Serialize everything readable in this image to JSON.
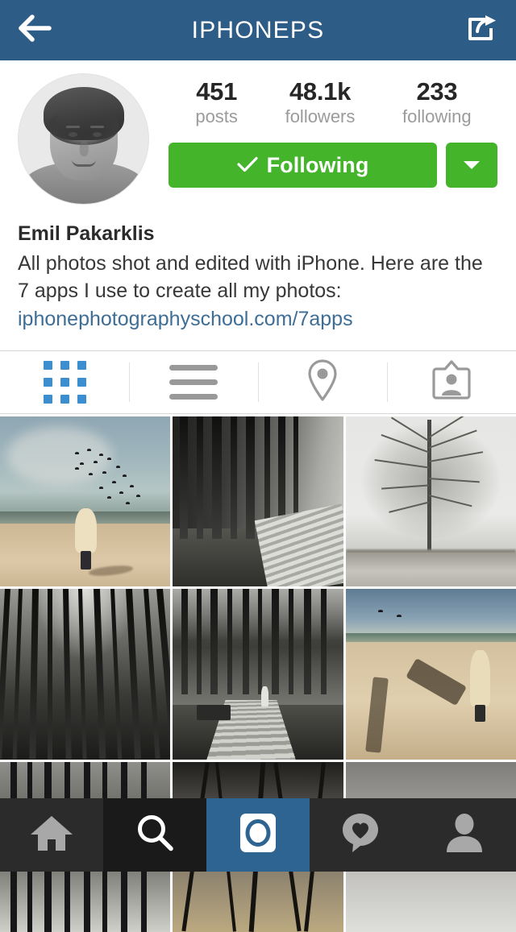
{
  "header": {
    "title": "IPHONEPS",
    "back_icon": "back-arrow-icon",
    "share_icon": "share-icon",
    "background_color": "#2d5c87"
  },
  "profile": {
    "avatar_alt": "profile-photo",
    "stats": [
      {
        "value": "451",
        "label": "posts"
      },
      {
        "value": "48.1k",
        "label": "followers"
      },
      {
        "value": "233",
        "label": "following"
      }
    ],
    "follow_button": {
      "label": "Following",
      "icon": "checkmark-icon",
      "color": "#44b52b"
    },
    "dropdown_button": {
      "icon": "caret-down-icon",
      "color": "#44b52b"
    },
    "bio": {
      "name": "Emil Pakarklis",
      "description": "All photos shot and edited with iPhone. Here are the 7 apps I use to create all my photos:",
      "link": "iphonephotographyschool.com/7apps",
      "link_color": "#3e6e96"
    }
  },
  "tabs": [
    {
      "name": "grid-view",
      "icon": "grid-icon",
      "active": true
    },
    {
      "name": "list-view",
      "icon": "list-icon",
      "active": false
    },
    {
      "name": "photo-map",
      "icon": "location-pin-icon",
      "active": false
    },
    {
      "name": "photos-of-you",
      "icon": "tagged-badge-icon",
      "active": false
    }
  ],
  "tab_active_color": "#3b8ed0",
  "tab_inactive_color": "#999999",
  "photos": [
    {
      "name": "beach-person-birds",
      "alt": "Person in cream coat on beach with flock of birds"
    },
    {
      "name": "forest-boardwalk-bw",
      "alt": "Black and white pine forest with boardwalk path"
    },
    {
      "name": "winter-bare-tree",
      "alt": "Bare tree in snowy winter field"
    },
    {
      "name": "forest-canopy-dark",
      "alt": "Dark tall pine trees looking upward"
    },
    {
      "name": "forest-path-figure",
      "alt": "Boardwalk through forest with distant figure"
    },
    {
      "name": "beach-long-shadows",
      "alt": "Beach with long shadows and person in coat"
    },
    {
      "name": "forest-trees-partial",
      "alt": "Forest trees partially visible"
    },
    {
      "name": "branches-partial",
      "alt": "Bare branches partially visible"
    },
    {
      "name": "gray-landscape-partial",
      "alt": "Gray landscape partially visible"
    }
  ],
  "bottom_nav": [
    {
      "name": "home",
      "icon": "home-icon",
      "state": "default"
    },
    {
      "name": "search",
      "icon": "search-icon",
      "state": "highlighted"
    },
    {
      "name": "camera",
      "icon": "camera-icon",
      "state": "active"
    },
    {
      "name": "activity",
      "icon": "heart-speech-icon",
      "state": "default"
    },
    {
      "name": "profile",
      "icon": "person-icon",
      "state": "default"
    }
  ]
}
